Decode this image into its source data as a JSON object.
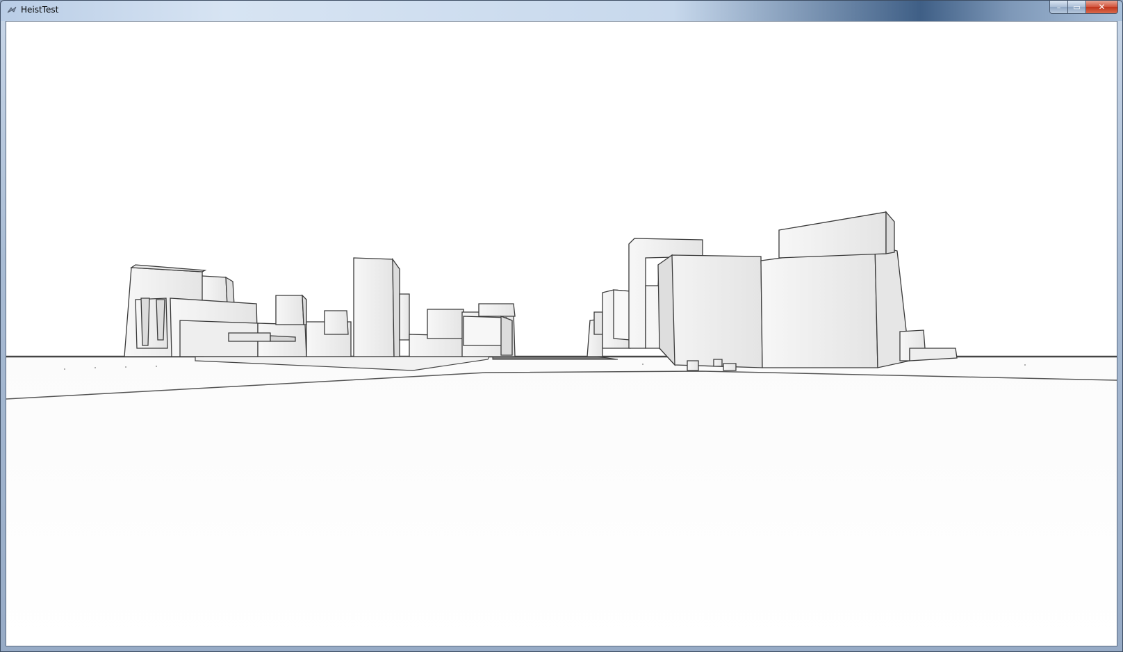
{
  "window": {
    "title": "HeistTest",
    "app_icon": "app-icon",
    "controls": {
      "minimize_icon": "minimize-icon",
      "maximize_icon": "maximize-icon",
      "close_icon": "close-icon",
      "minimize_glyph": "–",
      "maximize_glyph": "▭",
      "close_glyph": "✕"
    }
  },
  "scene": {
    "background": "#ffffff",
    "ground_color": "#ffffff",
    "line_color": "#333333",
    "building_fill": "#f4f4f4",
    "building_shade": "#e2e2e2"
  }
}
